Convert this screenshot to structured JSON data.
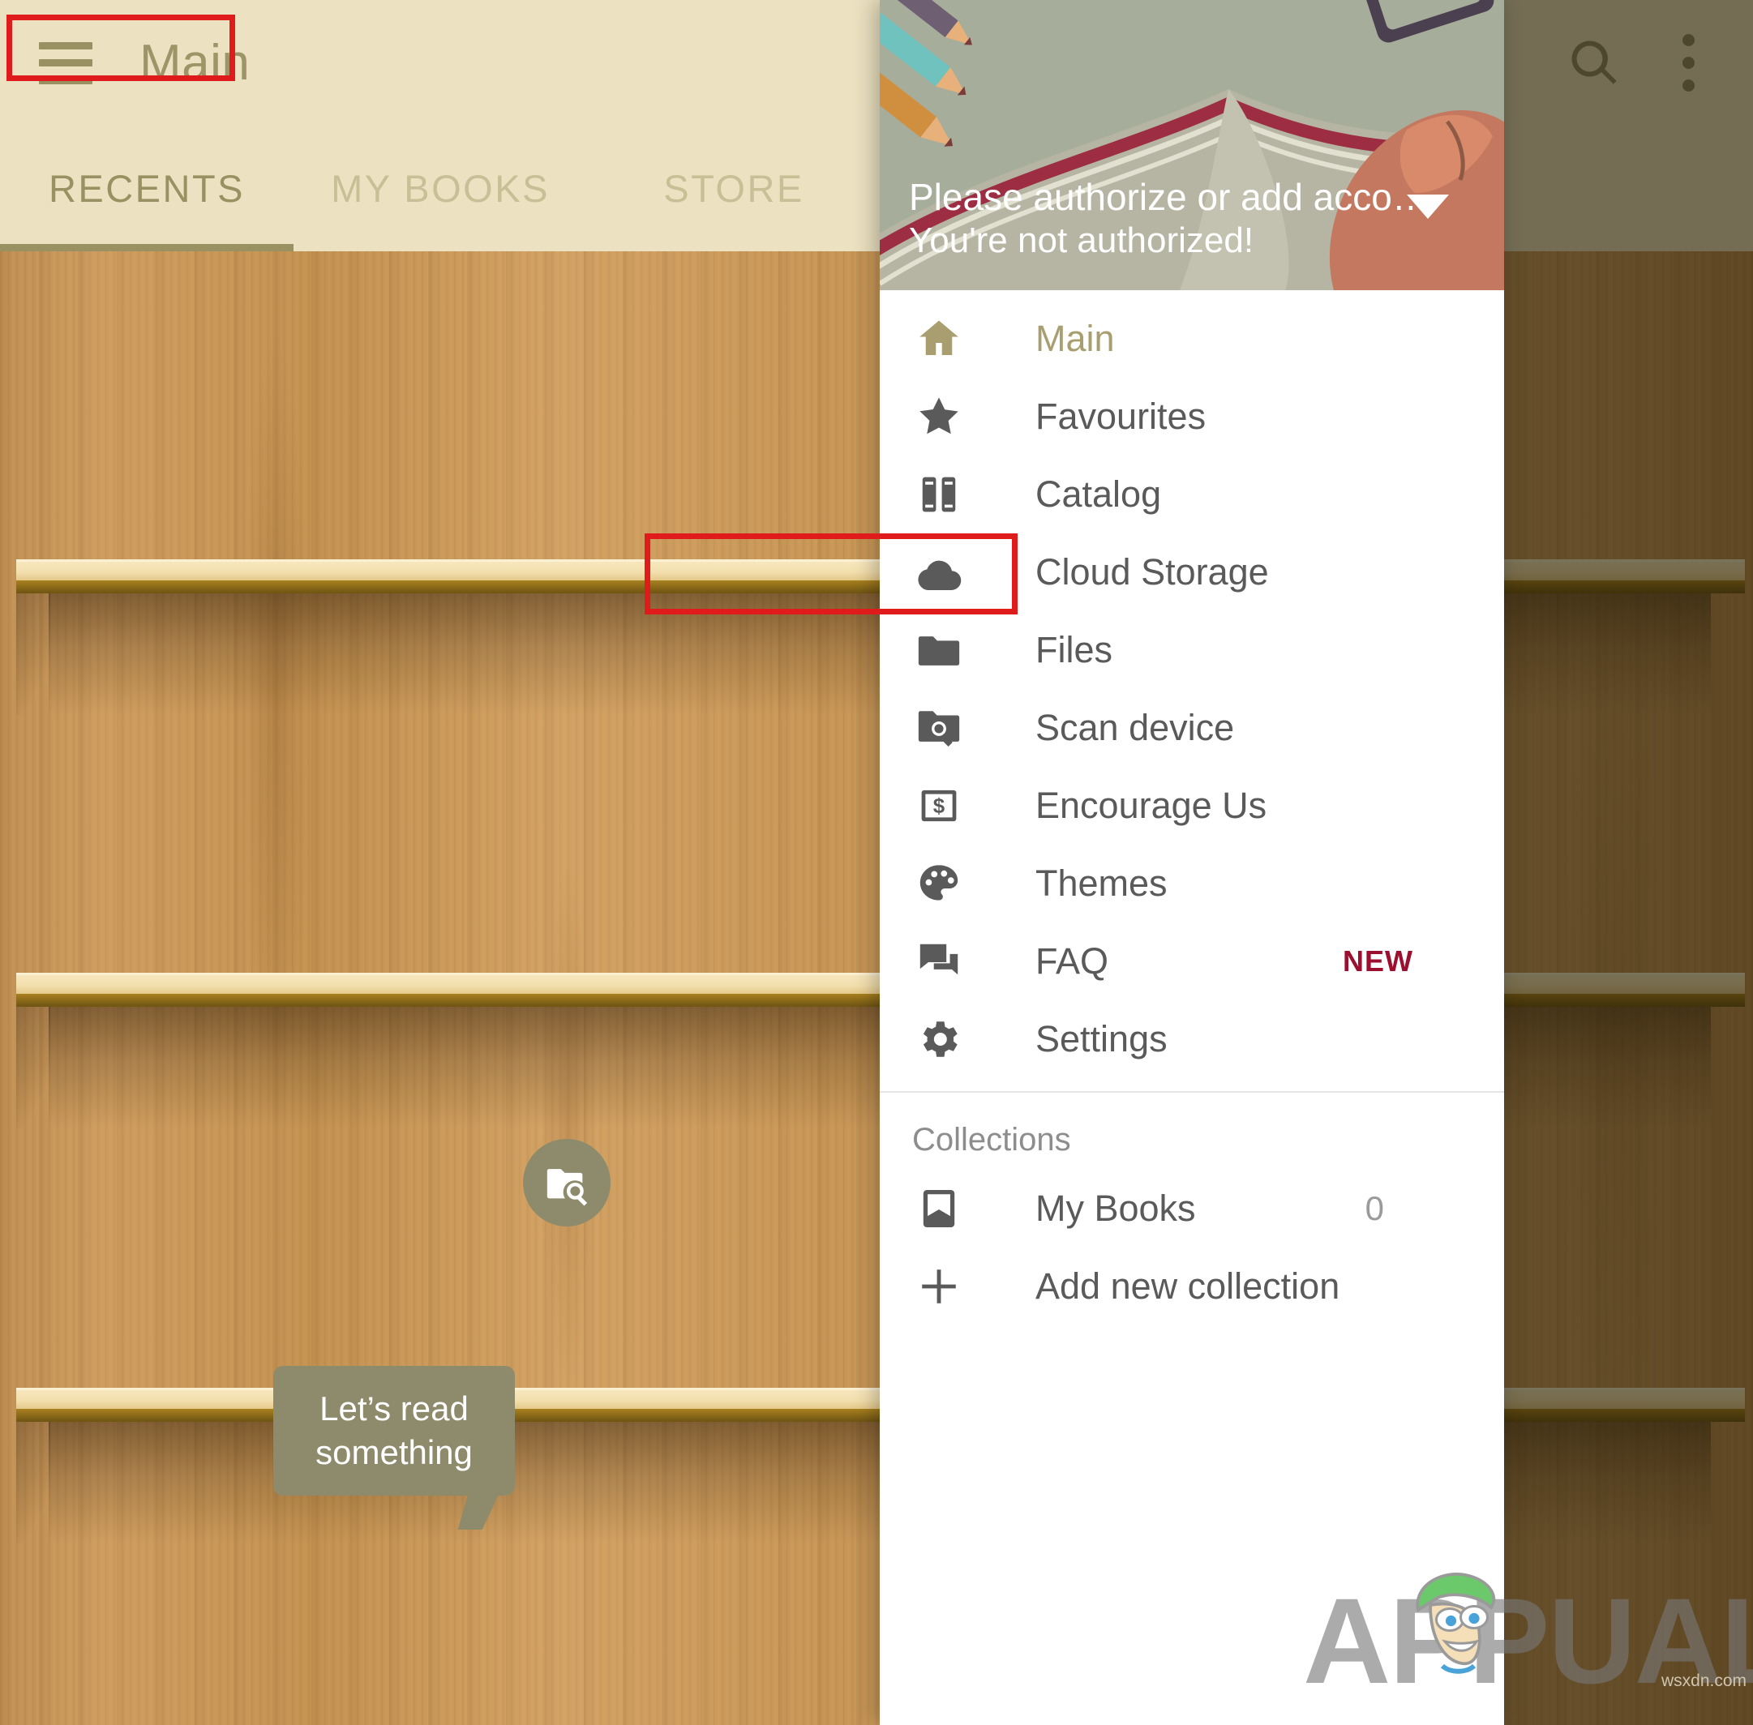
{
  "appbar": {
    "title": "Main",
    "menu_icon": "hamburger-icon",
    "search_icon": "search-icon",
    "overflow_icon": "more-vertical-icon"
  },
  "tabs": [
    {
      "label": "RECENTS",
      "active": true
    },
    {
      "label": "MY BOOKS",
      "active": false
    },
    {
      "label": "STORE",
      "active": false
    }
  ],
  "shelf_hint": {
    "bubble_line1": "Let’s read",
    "bubble_line2": "something",
    "fab_icon": "folder-search-icon"
  },
  "drawer": {
    "header": {
      "line1": "Please authorize or add acco…",
      "line2": "You're not authorized!",
      "caret_icon": "chevron-down-icon",
      "illustration": "open-book-pencils-hand-phone"
    },
    "items": [
      {
        "label": "Main",
        "icon": "home-icon",
        "active": true
      },
      {
        "label": "Favourites",
        "icon": "star-icon",
        "active": false
      },
      {
        "label": "Catalog",
        "icon": "books-icon",
        "active": false
      },
      {
        "label": "Cloud Storage",
        "icon": "cloud-icon",
        "active": false
      },
      {
        "label": "Files",
        "icon": "folder-icon",
        "active": false
      },
      {
        "label": "Scan device",
        "icon": "folder-search-icon",
        "active": false
      },
      {
        "label": "Encourage Us",
        "icon": "money-box-icon",
        "active": false
      },
      {
        "label": "Themes",
        "icon": "palette-icon",
        "active": false
      },
      {
        "label": "FAQ",
        "icon": "chat-icon",
        "active": false,
        "badge": "NEW"
      },
      {
        "label": "Settings",
        "icon": "gear-icon",
        "active": false
      }
    ],
    "collections": {
      "section_label": "Collections",
      "items": [
        {
          "label": "My Books",
          "icon": "book-outline-icon",
          "count": "0"
        },
        {
          "label": "Add new collection",
          "icon": "plus-icon"
        }
      ]
    }
  },
  "annotations": {
    "title_box": "highlight-app-title",
    "files_box": "highlight-files-item",
    "color": "#e01b1b"
  },
  "watermark": {
    "brand": "APPUALS",
    "source": "wsxdn.com"
  },
  "colors": {
    "appbar_bg": "#ece2c1",
    "accent_gold": "#9a9163",
    "drawer_active": "#a89e6f",
    "menu_text": "#5a5a5a",
    "badge_new": "#9c0f2e",
    "tooltip_bg": "#8e8b6d"
  }
}
